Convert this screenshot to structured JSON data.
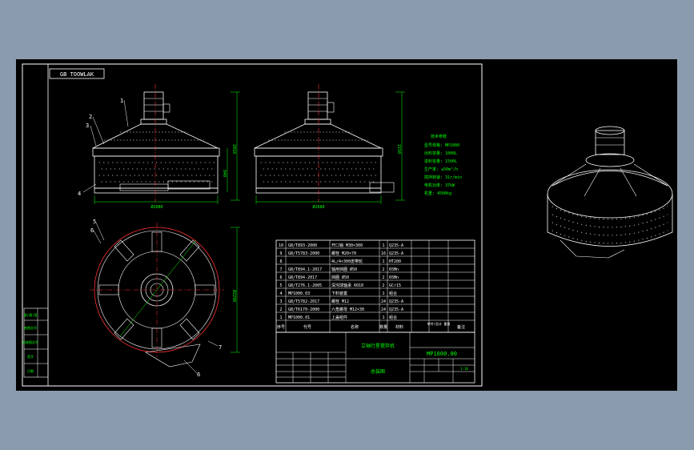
{
  "drawing": {
    "header_tag": "GB TOOWLAK",
    "part_numbers": [
      "1",
      "2",
      "3",
      "4",
      "5",
      "6",
      "7"
    ],
    "dimensions": {
      "front_width": "Ø2080",
      "side_width": "Ø2080",
      "front_total_height": "2010",
      "front_body_height": "840",
      "side_height": "2150",
      "plan_diameter": "Ø2290"
    },
    "specs": {
      "title": "技术参数",
      "lines": [
        "型号规格: MP1000",
        "出料容量: 1000L",
        "进料容量: 1500L",
        "生产率: ≥50m³/h",
        "搅拌转速: 31r/min",
        "电机功率: 37kW",
        "机重: 4500kg"
      ]
    },
    "parts_table": {
      "rows": [
        [
          "10",
          "GB/T893-2000",
          "开口销 M30×300",
          "1",
          "Q235-A",
          ""
        ],
        [
          "9",
          "GB/T5783-2000",
          "螺栓 M20×70",
          "16",
          "Q235-A",
          ""
        ],
        [
          "8",
          "",
          "4L/4×300皮带轮",
          "1",
          "HT200",
          ""
        ],
        [
          "7",
          "GB/T894.1-2017",
          "轴用挡圈 Ø50",
          "2",
          "65Mn",
          ""
        ],
        [
          "6",
          "GB/T894-2017",
          "挡圈 Ø50",
          "2",
          "65Mn",
          ""
        ],
        [
          "5",
          "GB/T276.1-2005",
          "深沟球轴承 6010",
          "2",
          "GCr15",
          ""
        ],
        [
          "4",
          "MP1000.03",
          "下料装置",
          "1",
          "组合",
          ""
        ],
        [
          "3",
          "GB/T5782-2017",
          "螺栓 M12",
          "24",
          "Q235-A",
          ""
        ],
        [
          "2",
          "GB/T6170-2000",
          "六角螺母 M12×30",
          "24",
          "Q235-A",
          ""
        ],
        [
          "1",
          "MP1000.01",
          "上盖组件",
          "1",
          "组合",
          ""
        ]
      ],
      "header": [
        "序号",
        "代号",
        "名称",
        "数量",
        "材料",
        "单件/总计 重量",
        "备注"
      ]
    },
    "title_block": {
      "product_name": "立轴行星搅拌机",
      "drawing_number": "MP1000.00",
      "sheet_title": "总装图",
      "scale": "1:10"
    },
    "left_strip": [
      "借(通)用",
      "底图总号",
      "旧底图总号",
      "签字",
      "日期"
    ]
  },
  "colors": {
    "background": "#8a9bad",
    "paper": "#000000",
    "lines": "#ffffff",
    "centerline": "#ff3333",
    "dimension": "#00ff00",
    "table": "#ffffff"
  }
}
